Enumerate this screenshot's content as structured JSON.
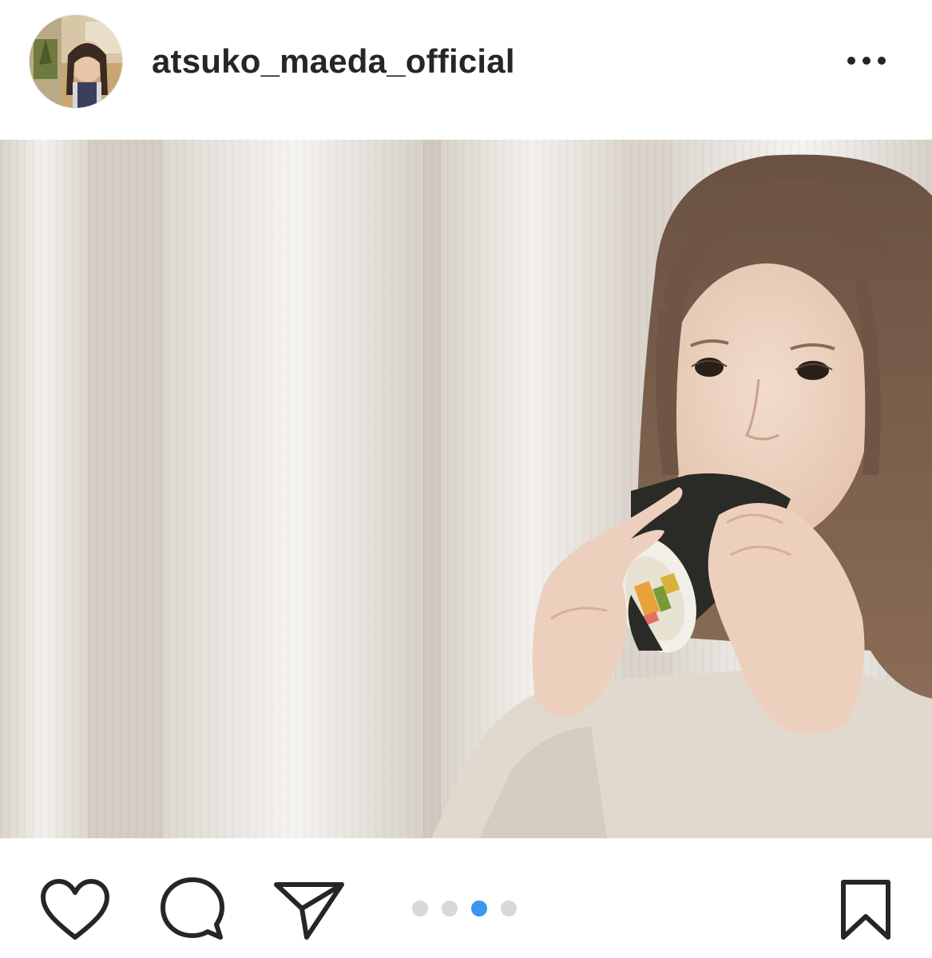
{
  "post": {
    "username": "atsuko_maeda_official",
    "avatar_icon": "profile-avatar",
    "more_icon": "more-options-icon"
  },
  "carousel": {
    "total_slides": 4,
    "active_index": 2,
    "active_color": "#3897f0",
    "inactive_color": "#d8d8d8"
  },
  "actions": {
    "like_icon": "heart-icon",
    "comment_icon": "comment-bubble-icon",
    "share_icon": "paper-plane-icon",
    "save_icon": "bookmark-icon"
  }
}
